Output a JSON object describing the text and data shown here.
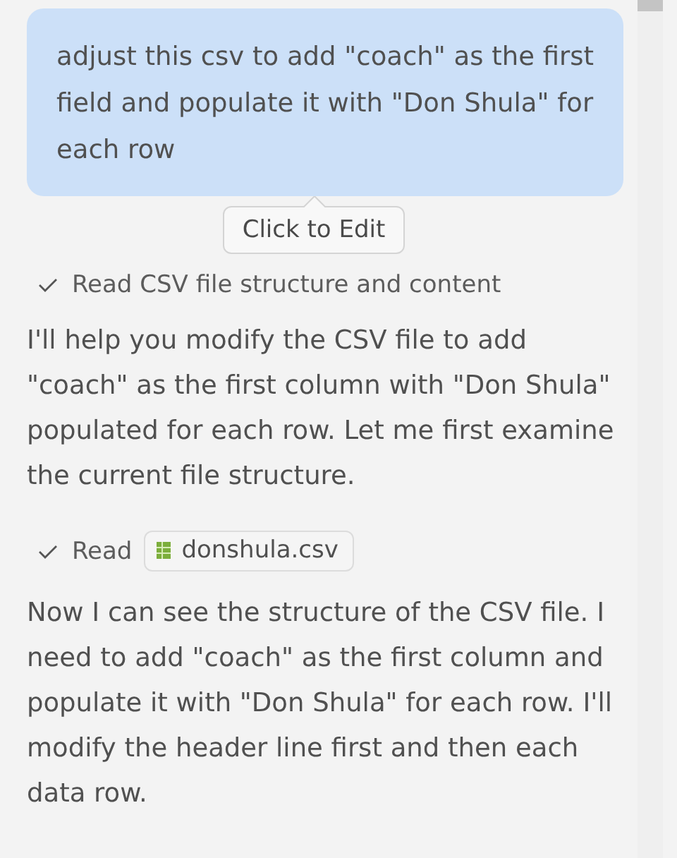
{
  "user_message": {
    "text": "adjust this csv to add \"coach\" as the first field and populate it with \"Don Shula\" for each row"
  },
  "tooltip": {
    "text": "Click to Edit"
  },
  "transcript": [
    {
      "kind": "step",
      "done": true,
      "label": "Read CSV file structure and content"
    },
    {
      "kind": "text",
      "text": "I'll help you modify the CSV file to add \"coach\" as the first column with \"Don Shula\" populated for each row. Let me first examine the current file structure."
    },
    {
      "kind": "file_step",
      "done": true,
      "label": "Read",
      "file": "donshula.csv"
    },
    {
      "kind": "text",
      "text": "Now I can see the structure of the CSV file. I need to add \"coach\" as the first column and populate it with \"Don Shula\" for each row. I'll modify the header line first and then each data row."
    }
  ]
}
